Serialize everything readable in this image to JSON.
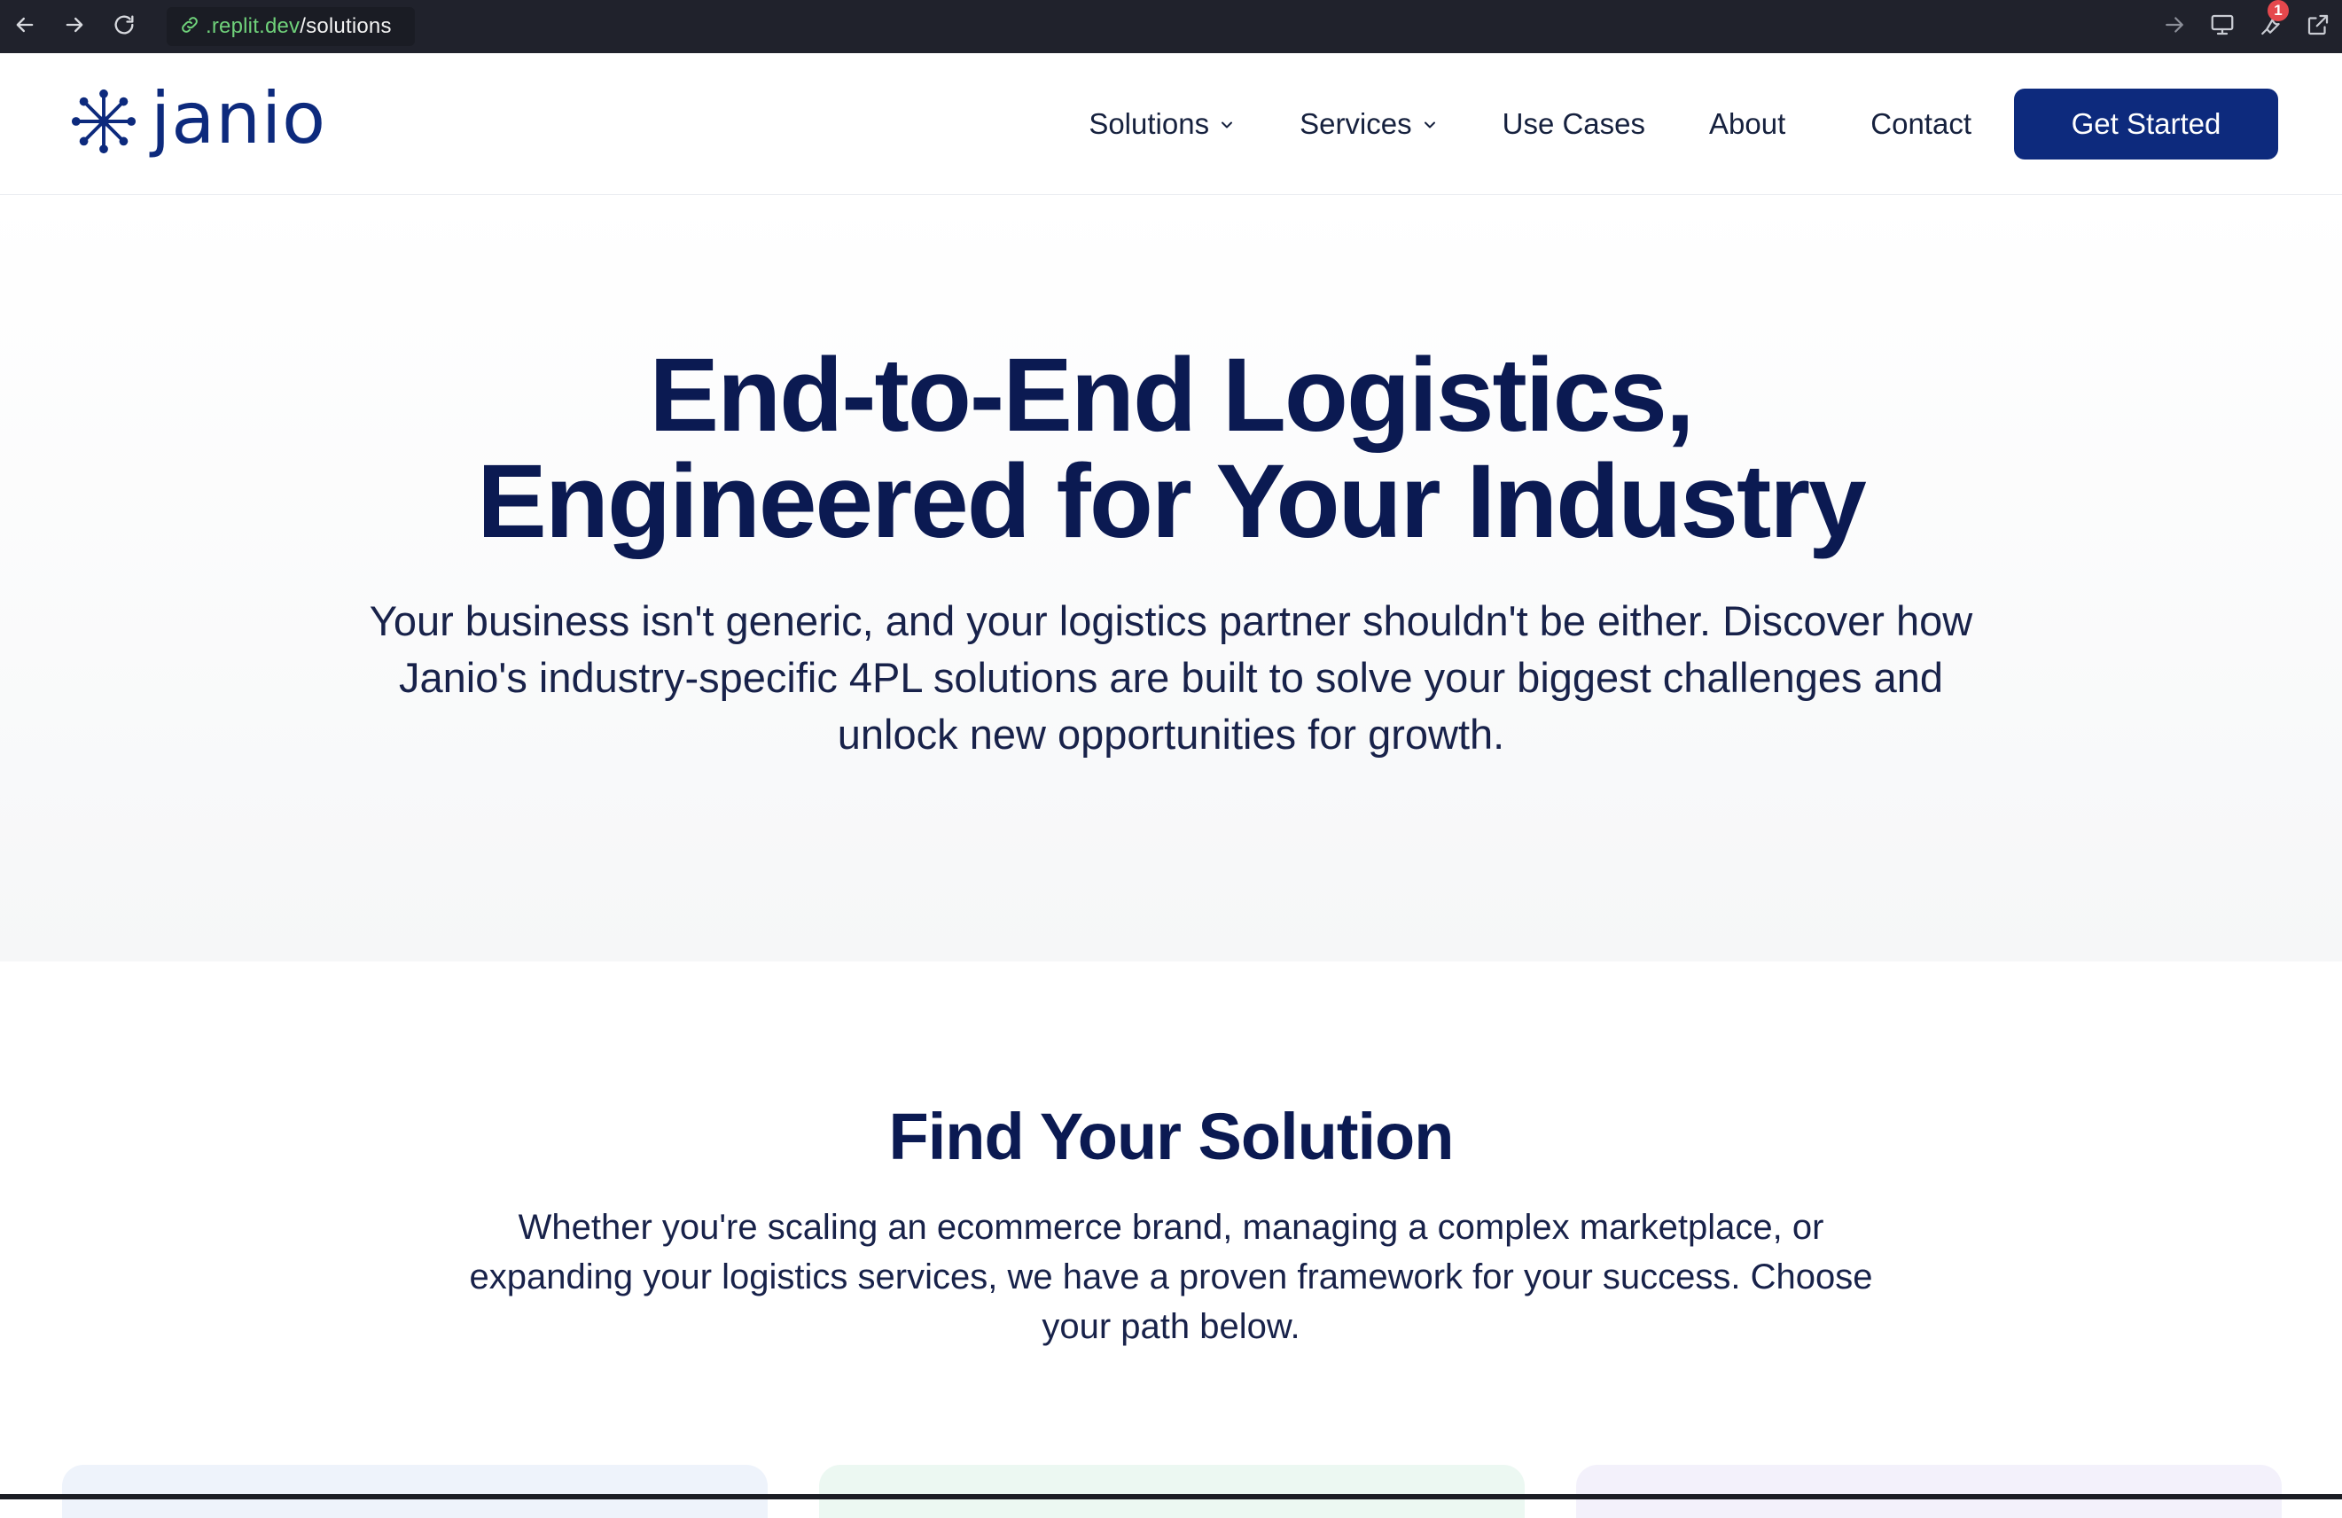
{
  "browser": {
    "url_domain": ".replit.dev",
    "url_path": "/solutions",
    "badge_count": "1"
  },
  "site": {
    "logo_text": "janio",
    "nav": {
      "solutions": "Solutions",
      "services": "Services",
      "use_cases": "Use Cases",
      "about": "About",
      "contact": "Contact",
      "cta": "Get Started"
    }
  },
  "hero": {
    "title_line1": "End-to-End Logistics,",
    "title_line2": "Engineered for Your Industry",
    "subtitle": "Your business isn't generic, and your logistics partner shouldn't be either. Discover how Janio's industry-specific 4PL solutions are built to solve your biggest challenges and unlock new opportunities for growth."
  },
  "find": {
    "title": "Find Your Solution",
    "text": "Whether you're scaling an ecommerce brand, managing a complex marketplace, or expanding your logistics services, we have a proven framework for your success. Choose your path below."
  },
  "colors": {
    "brand_navy": "#0d2a7d",
    "heading": "#0b1a52",
    "browser_bar": "#20222c",
    "url_domain": "#6fd17a"
  },
  "icons": [
    "back-arrow-icon",
    "forward-arrow-icon",
    "reload-icon",
    "link-icon",
    "arrow-right-icon",
    "monitor-icon",
    "tools-icon",
    "external-link-icon",
    "janio-logo-icon",
    "chevron-down-icon"
  ]
}
